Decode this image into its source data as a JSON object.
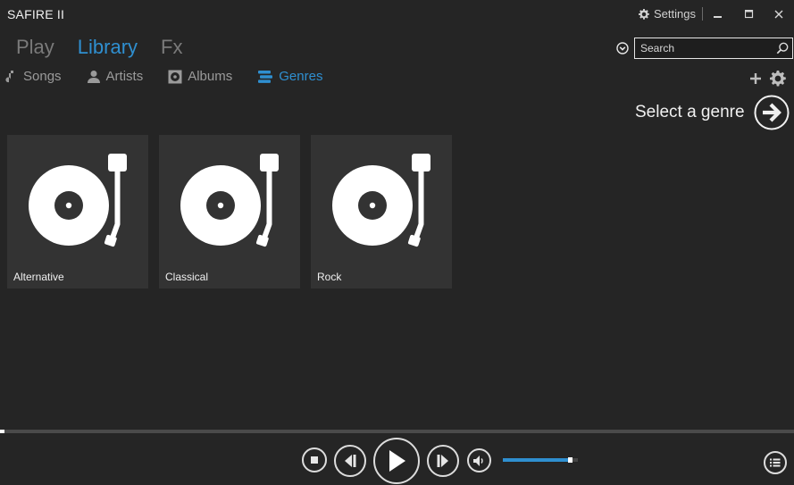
{
  "app": {
    "title": "SAFIRE II"
  },
  "titlebar": {
    "settings_label": "Settings"
  },
  "main_tabs": [
    {
      "label": "Play",
      "active": false
    },
    {
      "label": "Library",
      "active": true
    },
    {
      "label": "Fx",
      "active": false
    }
  ],
  "search": {
    "placeholder": "Search",
    "value": ""
  },
  "sub_tabs": [
    {
      "label": "Songs",
      "icon": "music-note-icon",
      "active": false
    },
    {
      "label": "Artists",
      "icon": "person-icon",
      "active": false
    },
    {
      "label": "Albums",
      "icon": "album-icon",
      "active": false
    },
    {
      "label": "Genres",
      "icon": "genres-icon",
      "active": true
    }
  ],
  "select_genre": {
    "label": "Select a genre"
  },
  "genres": [
    {
      "name": "Alternative",
      "icon": "turntable-icon"
    },
    {
      "name": "Classical",
      "icon": "turntable-icon"
    },
    {
      "name": "Rock",
      "icon": "turntable-icon"
    }
  ],
  "playback": {
    "progress": 0.005,
    "volume": 0.92
  },
  "colors": {
    "accent": "#2f8fd0",
    "background": "#252525",
    "tile": "#333333",
    "text": "#e6e6e6"
  }
}
